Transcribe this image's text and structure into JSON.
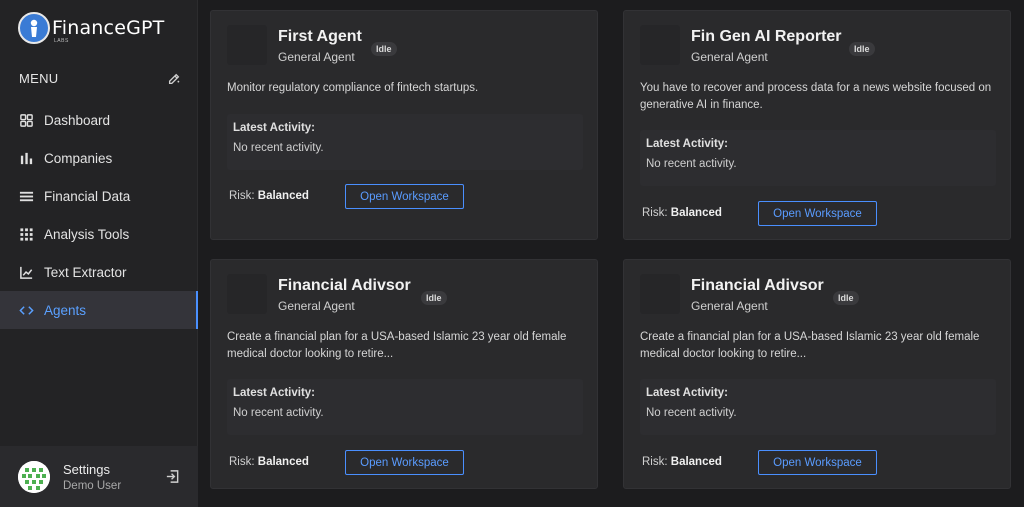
{
  "app": {
    "name": "FinanceGPT",
    "sub": "LABS"
  },
  "menu": {
    "title": "MENU"
  },
  "nav": [
    {
      "label": "Dashboard",
      "icon": "dashboard-icon"
    },
    {
      "label": "Companies",
      "icon": "bar-chart-icon"
    },
    {
      "label": "Financial Data",
      "icon": "list-icon"
    },
    {
      "label": "Analysis Tools",
      "icon": "grid-icon"
    },
    {
      "label": "Text Extractor",
      "icon": "line-chart-icon"
    },
    {
      "label": "Agents",
      "icon": "code-icon",
      "active": true
    }
  ],
  "user": {
    "title": "Settings",
    "name": "Demo User"
  },
  "cards": [
    {
      "title": "First Agent",
      "subtitle": "General Agent",
      "status": "Idle",
      "description": "Monitor regulatory compliance of fintech startups.",
      "activity_label": "Latest Activity:",
      "activity_value": "No recent activity.",
      "risk_label": "Risk:",
      "risk_value": "Balanced",
      "button": "Open Workspace"
    },
    {
      "title": "Fin Gen AI Reporter",
      "subtitle": "General Agent",
      "status": "Idle",
      "description": "You have to recover and process data for a news website focused on generative AI in finance.",
      "activity_label": "Latest Activity:",
      "activity_value": "No recent activity.",
      "risk_label": "Risk:",
      "risk_value": "Balanced",
      "button": "Open Workspace"
    },
    {
      "title": "Financial Adivsor",
      "subtitle": "General Agent",
      "status": "Idle",
      "description": "Create a financial plan for a USA-based Islamic 23 year old female medical doctor looking to retire...",
      "activity_label": "Latest Activity:",
      "activity_value": "No recent activity.",
      "risk_label": "Risk:",
      "risk_value": "Balanced",
      "button": "Open Workspace"
    },
    {
      "title": "Financial Adivsor",
      "subtitle": "General Agent",
      "status": "Idle",
      "description": "Create a financial plan for a USA-based Islamic 23 year old female medical doctor looking to retire...",
      "activity_label": "Latest Activity:",
      "activity_value": "No recent activity.",
      "risk_label": "Risk:",
      "risk_value": "Balanced",
      "button": "Open Workspace"
    }
  ],
  "colors": {
    "accent": "#4a90ff",
    "background": "#1c1c1e",
    "card": "#2a2a2c"
  }
}
